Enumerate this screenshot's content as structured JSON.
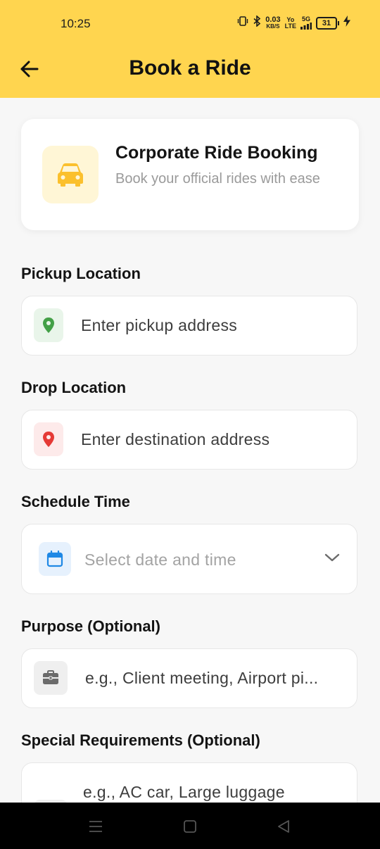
{
  "status": {
    "time": "10:25",
    "speed_value": "0.03",
    "speed_unit": "KB/S",
    "volte_top": "Yo",
    "volte_bottom": "LTE",
    "network": "5G",
    "battery": "31"
  },
  "header": {
    "title": "Book a Ride"
  },
  "card": {
    "title": "Corporate Ride Booking",
    "subtitle": "Book your official rides with ease"
  },
  "form": {
    "pickup_label": "Pickup Location",
    "pickup_placeholder": "Enter pickup address",
    "drop_label": "Drop Location",
    "drop_placeholder": "Enter destination address",
    "schedule_label": "Schedule Time",
    "schedule_placeholder": "Select date and time",
    "purpose_label": "Purpose (Optional)",
    "purpose_placeholder": "e.g., Client meeting, Airport pi...",
    "special_label": "Special Requirements (Optional)",
    "special_placeholder": "e.g., AC car, Large luggage"
  },
  "colors": {
    "accent": "#ffd54f",
    "pickup_icon": "#43a047",
    "drop_icon": "#e53935",
    "schedule_icon": "#1e88e5",
    "purpose_icon": "#6b6b6b"
  },
  "icons": {
    "back": "arrow-left-icon",
    "car": "car-icon",
    "pickup": "location-pin-icon",
    "drop": "location-pin-icon",
    "schedule": "calendar-icon",
    "dropdown": "chevron-down-icon",
    "purpose": "briefcase-icon",
    "nav_menu": "menu-icon",
    "nav_home": "home-square-icon",
    "nav_back": "back-triangle-icon"
  }
}
